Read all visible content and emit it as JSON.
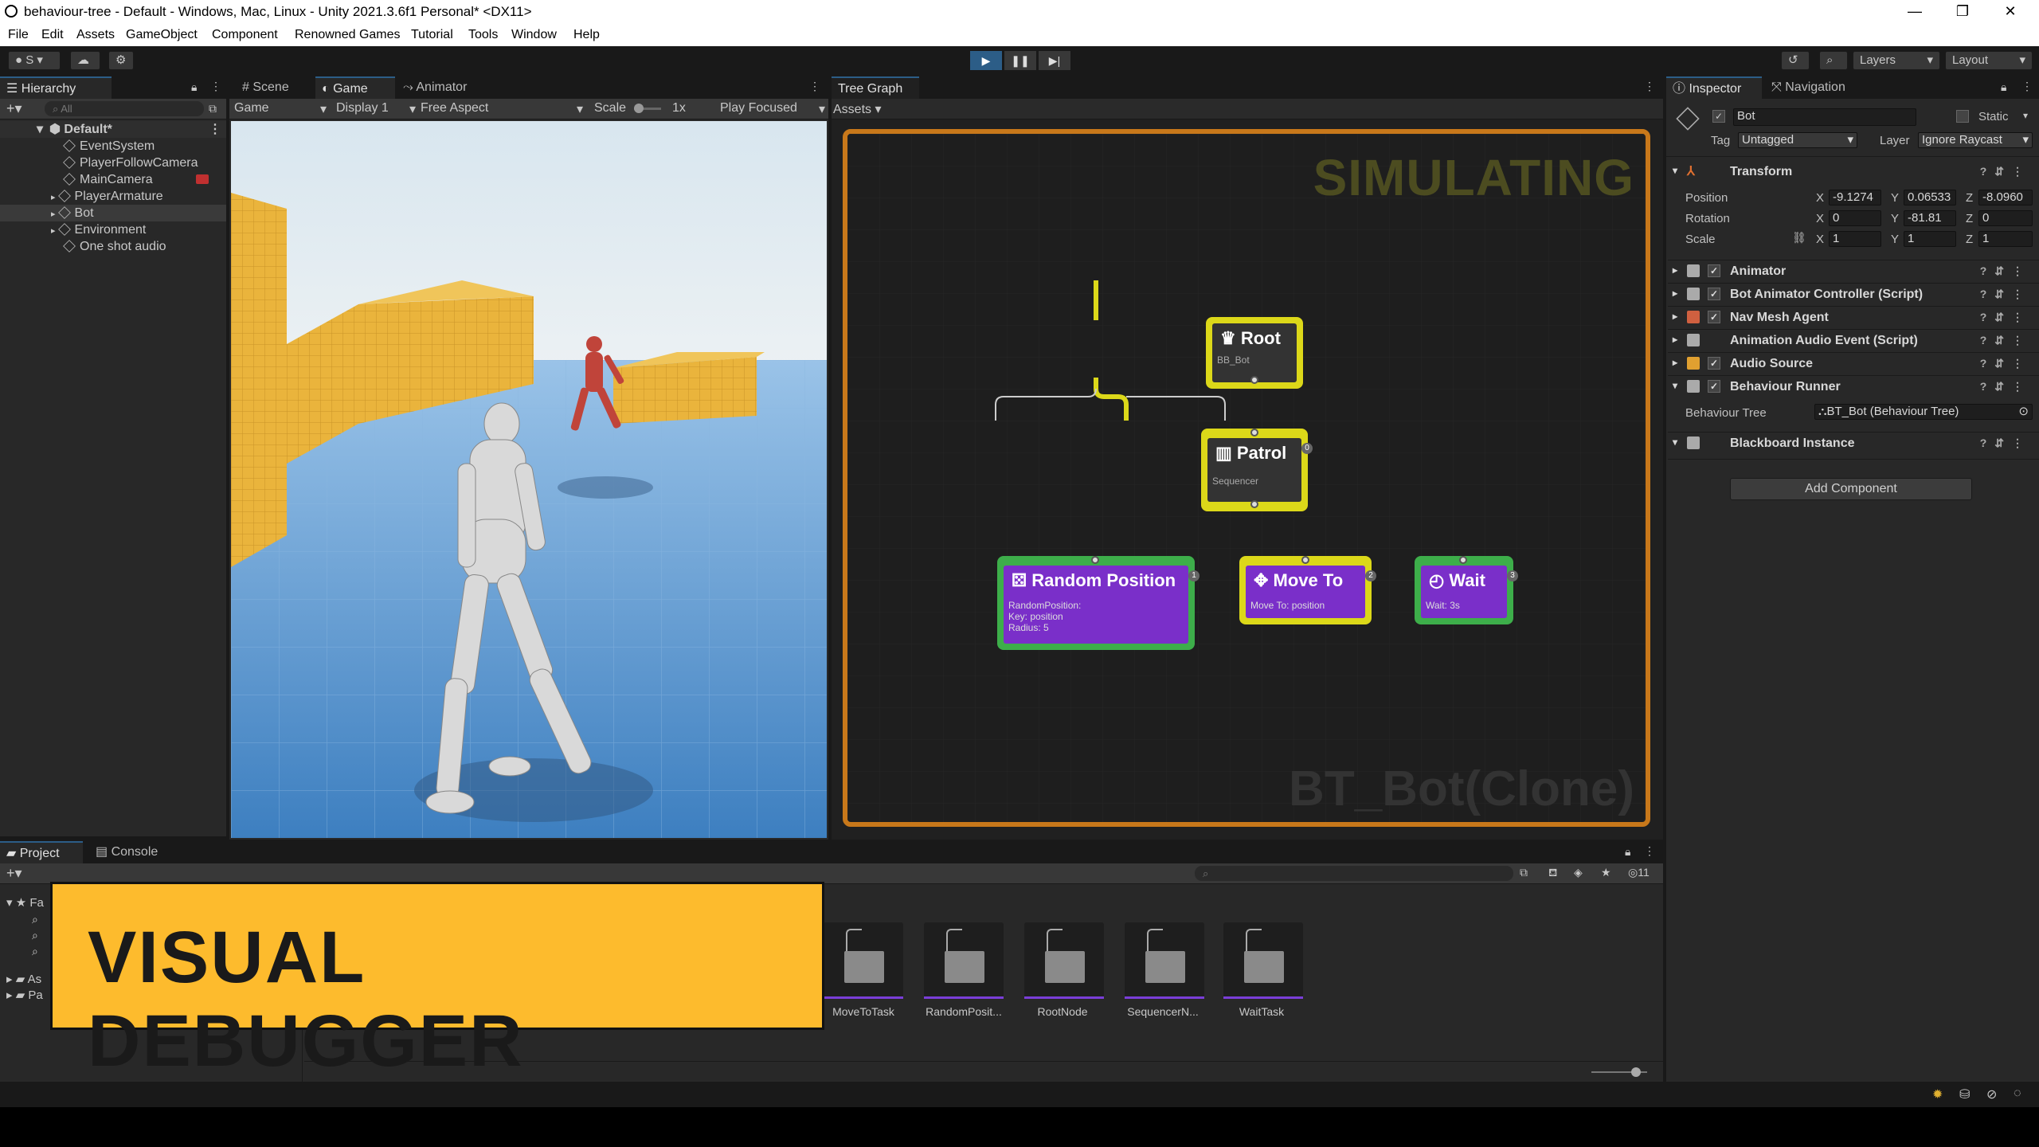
{
  "window": {
    "title": "behaviour-tree - Default - Windows, Mac, Linux - Unity 2021.3.6f1 Personal* <DX11>"
  },
  "menu": [
    "File",
    "Edit",
    "Assets",
    "GameObject",
    "Component",
    "Renowned Games",
    "Tutorial",
    "Tools",
    "Window",
    "Help"
  ],
  "toolbar": {
    "account": "S",
    "layers": "Layers",
    "layout": "Layout"
  },
  "hierarchy": {
    "tab": "Hierarchy",
    "search_placeholder": "All",
    "scene": "Default*",
    "items": [
      "EventSystem",
      "PlayerFollowCamera",
      "MainCamera",
      "PlayerArmature",
      "Bot",
      "Environment",
      "One shot audio"
    ]
  },
  "game_view": {
    "tabs": [
      "Scene",
      "Game",
      "Animator"
    ],
    "mode": "Game",
    "display": "Display 1",
    "aspect": "Free Aspect",
    "scale_label": "Scale",
    "scale_value": "1x",
    "play_focused": "Play Focused"
  },
  "tree_graph": {
    "tab": "Tree Graph",
    "assets_menu": "Assets",
    "status": "SIMULATING",
    "tree_name": "BT_Bot(Clone)",
    "nodes": {
      "root": {
        "title": "Root",
        "sub": "BB_Bot"
      },
      "patrol": {
        "title": "Patrol",
        "sub": "Sequencer"
      },
      "random": {
        "title": "Random Position",
        "sub1": "RandomPosition:",
        "sub2": "Key: position",
        "sub3": "Radius: 5",
        "index": "1"
      },
      "moveto": {
        "title": "Move To",
        "sub": "Move To: position",
        "index": "2"
      },
      "wait": {
        "title": "Wait",
        "sub": "Wait: 3s",
        "index": "3"
      },
      "patrol_index": "0"
    }
  },
  "inspector": {
    "tabs": [
      "Inspector",
      "Navigation"
    ],
    "object_name": "Bot",
    "static_label": "Static",
    "tag_label": "Tag",
    "tag_value": "Untagged",
    "layer_label": "Layer",
    "layer_value": "Ignore Raycast",
    "transform": {
      "title": "Transform",
      "position_label": "Position",
      "position": [
        "-9.1274",
        "0.06533",
        "-8.0960"
      ],
      "rotation_label": "Rotation",
      "rotation": [
        "0",
        "-81.81",
        "0"
      ],
      "scale_label": "Scale",
      "scale": [
        "1",
        "1",
        "1"
      ],
      "axes": [
        "X",
        "Y",
        "Z"
      ]
    },
    "components": [
      "Animator",
      "Bot Animator Controller (Script)",
      "Nav Mesh Agent",
      "Animation Audio Event (Script)",
      "Audio Source",
      "Behaviour Runner"
    ],
    "behaviour_tree_label": "Behaviour Tree",
    "behaviour_tree_value": "BT_Bot (Behaviour Tree)",
    "blackboard": "Blackboard Instance",
    "add_component": "Add Component"
  },
  "project": {
    "tabs": [
      "Project",
      "Console"
    ],
    "sidebar": [
      "Fa",
      "As",
      "Pa"
    ],
    "count": "11",
    "assets": [
      "MoveToTask",
      "RandomPosit...",
      "RootNode",
      "SequencerN...",
      "WaitTask"
    ]
  },
  "overlay_banner": "VISUAL DEBUGGER",
  "colors": {
    "banner": "#fdbb2d",
    "node_green": "#3dae4a",
    "node_yellow": "#dcd819",
    "node_purple": "#7a2fc9",
    "graph_border": "#c8781a",
    "simulating": "#4c4c20"
  }
}
